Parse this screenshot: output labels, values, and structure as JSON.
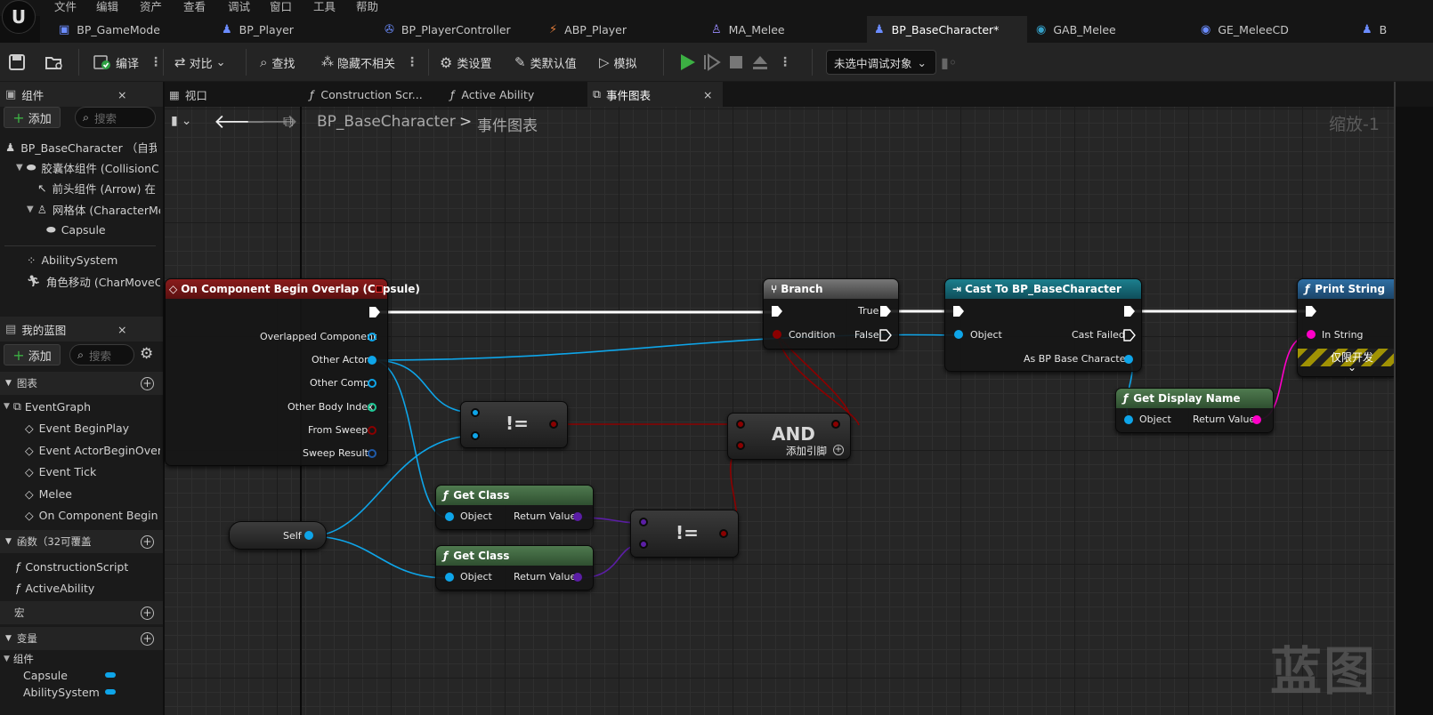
{
  "menu": [
    "文件",
    "编辑",
    "资产",
    "查看",
    "调试",
    "窗口",
    "工具",
    "帮助"
  ],
  "tabs": [
    {
      "label": "BP_GameMode",
      "icon": "blueprint-icon"
    },
    {
      "label": "BP_Player",
      "icon": "person-icon"
    },
    {
      "label": "BP_PlayerController",
      "icon": "gamepad-icon"
    },
    {
      "label": "ABP_Player",
      "icon": "anim-icon"
    },
    {
      "label": "MA_Melee",
      "icon": "montage-icon"
    },
    {
      "label": "BP_BaseCharacter*",
      "icon": "person-icon"
    },
    {
      "label": "GAB_Melee",
      "icon": "ability-icon"
    },
    {
      "label": "GE_MeleeCD",
      "icon": "effect-icon"
    },
    {
      "label": "B",
      "icon": "person-icon"
    }
  ],
  "toolbar": {
    "compile": "编译",
    "diff": "对比",
    "find": "查找",
    "hide": "隐藏不相关",
    "class_settings": "类设置",
    "class_defaults": "类默认值",
    "simulate": "模拟",
    "debug_target": "未选中调试对象"
  },
  "components_panel": {
    "title": "组件",
    "add": "添加",
    "search": "搜索",
    "items": [
      "BP_BaseCharacter （自我",
      "胶囊体组件 (CollisionC",
      "前头组件 (Arrow) 在",
      "网格体 (CharacterMe",
      "Capsule",
      "AbilitySystem",
      "角色移动 (CharMoveC"
    ]
  },
  "my_blueprint": {
    "title": "我的蓝图",
    "add": "添加",
    "search": "搜索",
    "graphs_label": "图表",
    "event_graph": "EventGraph",
    "events": [
      "Event BeginPlay",
      "Event ActorBeginOverla",
      "Event Tick",
      "Melee",
      "On Component Begin Ov"
    ],
    "functions_label": "函数（32可覆盖",
    "functions": [
      "ConstructionScript",
      "ActiveAbility"
    ],
    "macros_label": "宏",
    "variables_label": "变量",
    "components_label": "组件",
    "vars": [
      "Capsule",
      "AbilitySystem"
    ]
  },
  "graph_tabs": [
    "视口",
    "Construction Scr...",
    "Active Ability",
    "事件图表"
  ],
  "breadcrumb": {
    "root": "BP_BaseCharacter",
    "sep": ">",
    "current": "事件图表"
  },
  "zoom": "缩放-1",
  "watermark": "蓝图",
  "nodes": {
    "overlap": {
      "title": "On Component Begin Overlap (Capsule)",
      "pins": [
        "Overlapped Component",
        "Other Actor",
        "Other Comp",
        "Other Body Index",
        "From Sweep",
        "Sweep Result"
      ]
    },
    "branch": {
      "title": "Branch",
      "condition": "Condition",
      "true": "True",
      "false": "False"
    },
    "cast": {
      "title": "Cast To BP_BaseCharacter",
      "object": "Object",
      "failed": "Cast Failed",
      "as": "As BP Base Character"
    },
    "print": {
      "title": "Print String",
      "in_string": "In String",
      "dev_only": "仅限开发"
    },
    "display": {
      "title": "Get Display Name",
      "object": "Object",
      "ret": "Return Value"
    },
    "neq1": {
      "sym": "!="
    },
    "neq2": {
      "sym": "!="
    },
    "and": {
      "title": "AND",
      "add": "添加引脚"
    },
    "getclass1": {
      "title": "Get Class",
      "object": "Object",
      "ret": "Return Value"
    },
    "getclass2": {
      "title": "Get Class",
      "object": "Object",
      "ret": "Return Value"
    },
    "self": {
      "label": "Self"
    }
  },
  "colors": {
    "exec": "#ffffff",
    "object": "#0ea5e9",
    "bool": "#8b0000",
    "class": "#5b1ea5",
    "string": "#ff00c8",
    "struct": "#1e5aa8",
    "int": "#20c997"
  }
}
